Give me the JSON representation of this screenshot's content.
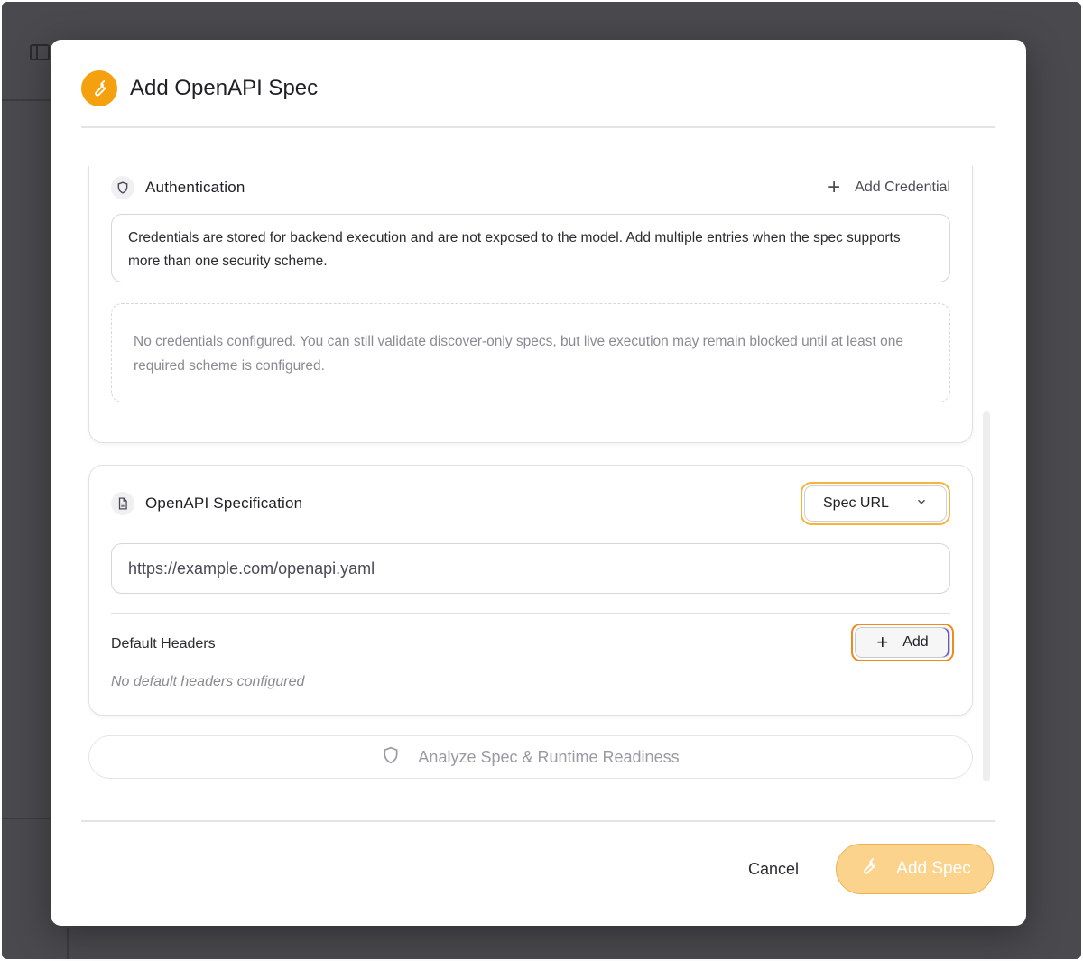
{
  "dialog": {
    "title": "Add OpenAPI Spec",
    "header_icon": "wrench-icon"
  },
  "authentication": {
    "title": "Authentication",
    "icon": "shield-icon",
    "add_credential_label": "Add Credential",
    "info_text": "Credentials are stored for backend execution and are not exposed to the model. Add multiple entries when the spec supports more than one security scheme.",
    "empty_text": "No credentials configured. You can still validate discover-only specs, but live execution may remain blocked until at least one required scheme is configured."
  },
  "specification": {
    "title": "OpenAPI Specification",
    "icon": "document-icon",
    "source_select": {
      "selected": "Spec URL"
    },
    "url_value": "https://example.com/openapi.yaml",
    "default_headers_label": "Default Headers",
    "default_headers_empty": "No default headers configured",
    "add_header_label": "Add"
  },
  "analyze_button_label": "Analyze Spec & Runtime Readiness",
  "footer": {
    "cancel_label": "Cancel",
    "submit_label": "Add Spec"
  },
  "colors": {
    "accent": "#f5a10f",
    "submit_disabled": "#fbd38d",
    "focus_ring": "#ef8a1f"
  }
}
